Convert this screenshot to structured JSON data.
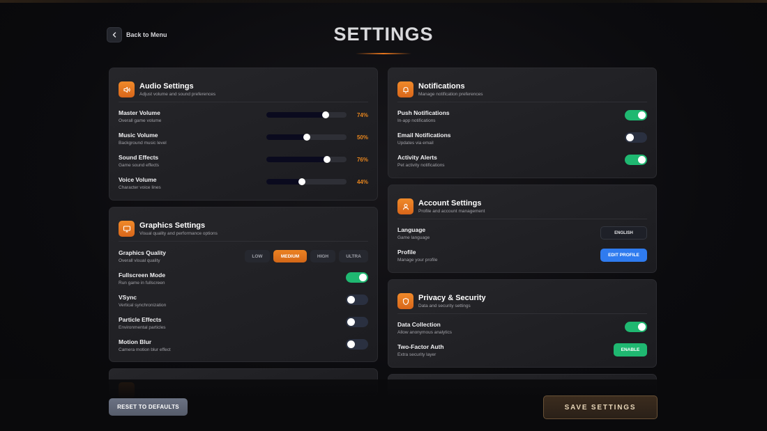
{
  "header": {
    "back_label": "Back to Menu",
    "title": "SETTINGS"
  },
  "audio": {
    "title": "Audio Settings",
    "subtitle": "Adjust volume and sound preferences",
    "sliders": [
      {
        "label": "Master Volume",
        "sub": "Overall game volume",
        "value": 74,
        "display": "74%"
      },
      {
        "label": "Music Volume",
        "sub": "Background music level",
        "value": 50,
        "display": "50%"
      },
      {
        "label": "Sound Effects",
        "sub": "Game sound effects",
        "value": 76,
        "display": "76%"
      },
      {
        "label": "Voice Volume",
        "sub": "Character voice lines",
        "value": 44,
        "display": "44%"
      }
    ]
  },
  "graphics": {
    "title": "Graphics Settings",
    "subtitle": "Visual quality and performance options",
    "quality": {
      "label": "Graphics Quality",
      "sub": "Overall visual quality",
      "options": [
        "LOW",
        "MEDIUM",
        "HIGH",
        "ULTRA"
      ],
      "selected": "MEDIUM"
    },
    "toggles": [
      {
        "label": "Fullscreen Mode",
        "sub": "Run game in fullscreen",
        "on": true
      },
      {
        "label": "VSync",
        "sub": "Vertical synchronization",
        "on": false
      },
      {
        "label": "Particle Effects",
        "sub": "Environmental particles",
        "on": false
      },
      {
        "label": "Motion Blur",
        "sub": "Camera motion blur effect",
        "on": false
      }
    ]
  },
  "notifications": {
    "title": "Notifications",
    "subtitle": "Manage notification preferences",
    "toggles": [
      {
        "label": "Push Notifications",
        "sub": "In-app notifications",
        "on": true
      },
      {
        "label": "Email Notifications",
        "sub": "Updates via email",
        "on": false
      },
      {
        "label": "Activity Alerts",
        "sub": "Pet activity notifications",
        "on": true
      }
    ]
  },
  "account": {
    "title": "Account Settings",
    "subtitle": "Profile and account management",
    "language": {
      "label": "Language",
      "sub": "Game language",
      "value": "ENGLISH"
    },
    "profile": {
      "label": "Profile",
      "sub": "Manage your profile",
      "button": "EDIT PROFILE"
    }
  },
  "privacy": {
    "title": "Privacy & Security",
    "subtitle": "Data and security settings",
    "data_collection": {
      "label": "Data Collection",
      "sub": "Allow anonymous analytics",
      "on": true
    },
    "two_factor": {
      "label": "Two-Factor Auth",
      "sub": "Extra security layer",
      "button": "ENABLE"
    }
  },
  "footer": {
    "reset_label": "RESET TO DEFAULTS",
    "save_label": "SAVE SETTINGS"
  },
  "colors": {
    "accent": "#e8761d",
    "toggle_on": "#1fb871",
    "toggle_off": "#2a3040",
    "blue_button": "#2f7bef"
  }
}
